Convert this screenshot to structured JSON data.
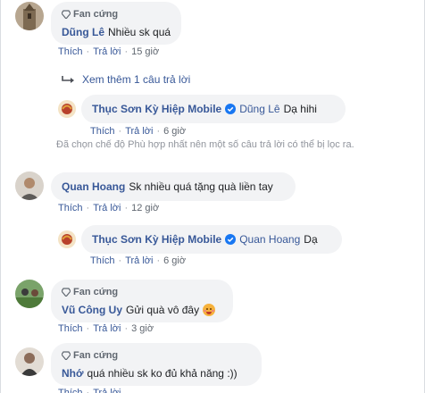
{
  "labels": {
    "fan_badge": "Fan cứng",
    "like": "Thích",
    "reply": "Trả lời",
    "separator": "·"
  },
  "more_replies": "Xem thêm 1 câu trả lời",
  "filter_notice": "Đã chọn chế độ Phù hợp nhất nên một số câu trả lời có thể bị lọc ra.",
  "comments": [
    {
      "author": "Dũng Lê",
      "text": "Nhiều sk quá",
      "time": "15 giờ"
    },
    {
      "author": "Thục Sơn Kỳ Hiệp Mobile",
      "mention": "Dũng Lê",
      "text": "Dạ hihi",
      "time": "6 giờ"
    },
    {
      "author": "Quan Hoang",
      "text": "Sk nhiều quá tặng quà liền tay",
      "time": "12 giờ"
    },
    {
      "author": "Thục Sơn Kỳ Hiệp Mobile",
      "mention": "Quan Hoang",
      "text": "Dạ",
      "time": "6 giờ"
    },
    {
      "author": "Vũ Công Uy",
      "text": "Gửi quà vô đây",
      "time": "3 giờ"
    },
    {
      "author": "Nhớ",
      "text": "quá nhiều sk ko đủ khả năng :))"
    }
  ],
  "colors": {
    "link": "#385898",
    "bubble": "#f2f3f5",
    "meta": "#606770",
    "verified": "#1877f2"
  },
  "icons": [
    "diamond-icon",
    "reply-arrow-icon",
    "verified-badge-icon",
    "smiley-emoji-icon"
  ]
}
